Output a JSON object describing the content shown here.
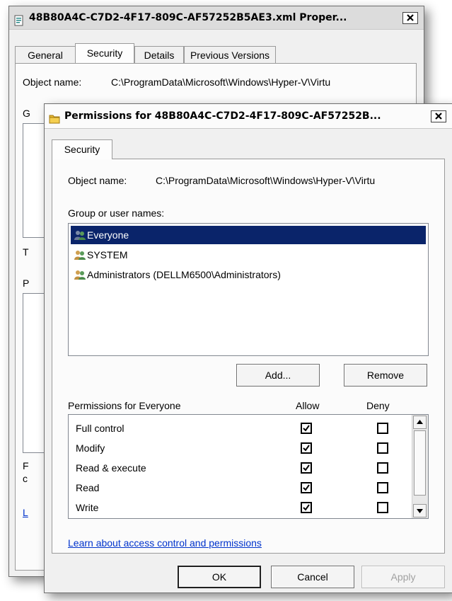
{
  "back_window": {
    "title": "48B80A4C-C7D2-4F17-809C-AF57252B5AE3.xml Proper...",
    "tabs": [
      "General",
      "Security",
      "Details",
      "Previous Versions"
    ],
    "object_name_label": "Object name:",
    "object_name_value": "C:\\ProgramData\\Microsoft\\Windows\\Hyper-V\\Virtu",
    "clipped_letters": [
      "G",
      "T",
      "P",
      "F",
      "c",
      "L"
    ]
  },
  "front_window": {
    "title": "Permissions for 48B80A4C-C7D2-4F17-809C-AF57252B...",
    "tab": "Security",
    "object_name_label": "Object name:",
    "object_name_value": "C:\\ProgramData\\Microsoft\\Windows\\Hyper-V\\Virtu",
    "group_label": "Group or user names:",
    "users": [
      {
        "name": "Everyone",
        "selected": true
      },
      {
        "name": "SYSTEM",
        "selected": false
      },
      {
        "name": "Administrators (DELLM6500\\Administrators)",
        "selected": false
      }
    ],
    "add_button": "Add...",
    "remove_button": "Remove",
    "permissions_label": "Permissions for Everyone",
    "allow_header": "Allow",
    "deny_header": "Deny",
    "permissions": [
      {
        "name": "Full control",
        "allow": true,
        "deny": false
      },
      {
        "name": "Modify",
        "allow": true,
        "deny": false
      },
      {
        "name": "Read & execute",
        "allow": true,
        "deny": false
      },
      {
        "name": "Read",
        "allow": true,
        "deny": false
      },
      {
        "name": "Write",
        "allow": true,
        "deny": false
      }
    ],
    "learn_link": "Learn about access control and permissions",
    "ok_button": "OK",
    "cancel_button": "Cancel",
    "apply_button": "Apply"
  }
}
